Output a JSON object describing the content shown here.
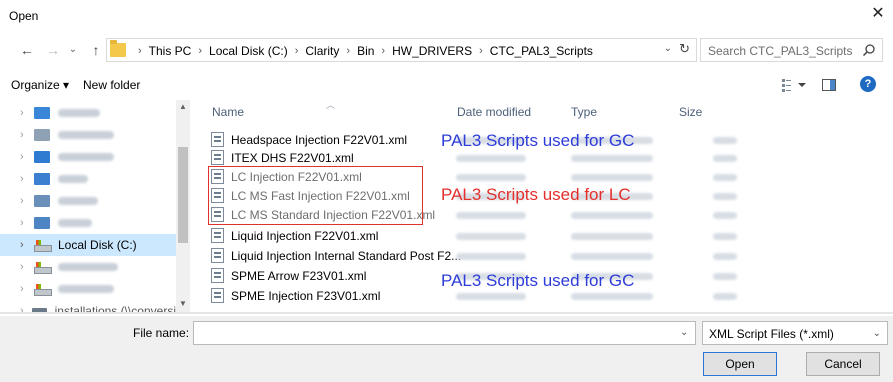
{
  "window": {
    "title": "Open",
    "close_glyph": "✕"
  },
  "nav": {
    "back": "←",
    "forward": "→",
    "recent": "⌄",
    "up": "↑"
  },
  "address": {
    "crumbs": [
      "This PC",
      "Local Disk (C:)",
      "Clarity",
      "Bin",
      "HW_DRIVERS",
      "CTC_PAL3_Scripts"
    ],
    "dropdown": "⌄",
    "refresh": "↻"
  },
  "search": {
    "placeholder": "Search CTC_PAL3_Scripts",
    "icon": "search-icon"
  },
  "toolbar": {
    "organize_label": "Organize ▾",
    "new_folder_label": "New folder",
    "help": "?"
  },
  "navpane": {
    "items": [
      {
        "label": "",
        "blurred": true,
        "color": "#3a86d8"
      },
      {
        "label": "",
        "blurred": true,
        "color": "#7f8fa3"
      },
      {
        "label": "",
        "blurred": true,
        "color": "#2e7bd1"
      },
      {
        "label": "",
        "blurred": true,
        "color": "#3b7fd0"
      },
      {
        "label": "",
        "blurred": true,
        "color": "#6a8fb8"
      },
      {
        "label": "",
        "blurred": true,
        "color": "#4d84c4"
      },
      {
        "label": "Local Disk (C:)",
        "blurred": false,
        "selected": true
      },
      {
        "label": "",
        "blurred": true,
        "color": "#888"
      },
      {
        "label": "",
        "blurred": true,
        "color": "#888"
      },
      {
        "label": "installations (\\\\conversi",
        "blurred": false
      }
    ]
  },
  "columns": {
    "name": "Name",
    "date": "Date modified",
    "type": "Type",
    "size": "Size"
  },
  "files": [
    {
      "name": "Headspace Injection F22V01.xml",
      "dim": false
    },
    {
      "name": "ITEX DHS F22V01.xml",
      "dim": false
    },
    {
      "name": "LC Injection F22V01.xml",
      "dim": true
    },
    {
      "name": "LC MS Fast Injection F22V01.xml",
      "dim": true
    },
    {
      "name": "LC MS Standard Injection F22V01.xml",
      "dim": true
    },
    {
      "name": "Liquid Injection F22V01.xml",
      "dim": false
    },
    {
      "name": "Liquid Injection Internal Standard Post F2...",
      "dim": false
    },
    {
      "name": "SPME Arrow F23V01.xml",
      "dim": false
    },
    {
      "name": "SPME Injection F23V01.xml",
      "dim": false
    }
  ],
  "annotations": {
    "gc_top": "PAL3 Scripts used for GC",
    "lc": "PAL3 Scripts used for LC",
    "gc_bottom": "PAL3 Scripts used for GC",
    "gc_color": "#2e3cd8",
    "lc_color": "#e3302c"
  },
  "bottom": {
    "file_name_label": "File name:",
    "file_name_value": "",
    "filter_value": "XML Script Files (*.xml)",
    "open_label": "Open",
    "cancel_label": "Cancel"
  }
}
